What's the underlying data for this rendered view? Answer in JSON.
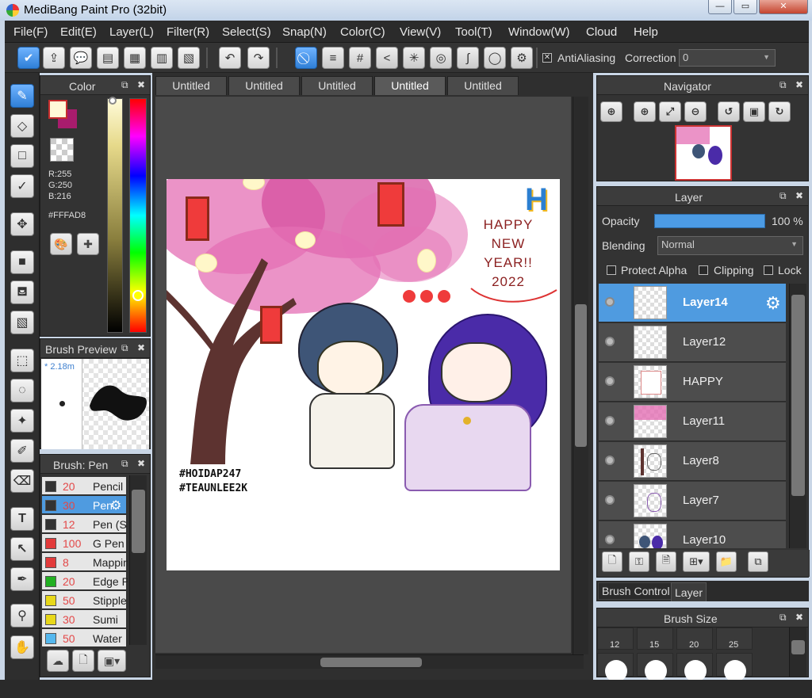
{
  "titlebar": {
    "title": "MediBang Paint Pro (32bit)"
  },
  "menu": [
    "File(F)",
    "Edit(E)",
    "Layer(L)",
    "Filter(R)",
    "Select(S)",
    "Snap(N)",
    "Color(C)",
    "View(V)",
    "Tool(T)",
    "Window(W)",
    "Cloud",
    "Help"
  ],
  "toolbar": {
    "antialiasing_label": "AntiAliasing",
    "correction_label": "Correction",
    "correction_value": "0"
  },
  "color_panel": {
    "title": "Color",
    "r": "R:255",
    "g": "G:250",
    "b": "B:216",
    "hex": "#FFFAD8",
    "fg_color": "#FFFAD8",
    "bg_color": "#A81C6D"
  },
  "brush_preview": {
    "title": "Brush Preview",
    "size": "* 2.18m"
  },
  "brush_panel": {
    "title": "Brush: Pen",
    "items": [
      {
        "size": "20",
        "name": "Pencil",
        "color": "#333333"
      },
      {
        "size": "30",
        "name": "Pen",
        "color": "#333333"
      },
      {
        "size": "12",
        "name": "Pen (S",
        "color": "#333333"
      },
      {
        "size": "100",
        "name": "G Pen",
        "color": "#e23b3b"
      },
      {
        "size": "8",
        "name": "Mappin",
        "color": "#e23b3b"
      },
      {
        "size": "20",
        "name": "Edge P",
        "color": "#22b022"
      },
      {
        "size": "50",
        "name": "Stipple",
        "color": "#e8d81a"
      },
      {
        "size": "30",
        "name": "Sumi",
        "color": "#e8d81a"
      },
      {
        "size": "50",
        "name": "Water",
        "color": "#55b8ee"
      }
    ]
  },
  "tabs": [
    "Untitled",
    "Untitled",
    "Untitled",
    "Untitled",
    "Untitled"
  ],
  "artwork": {
    "greeting": [
      "HAPPY",
      "NEW",
      "YEAR!!",
      "2022"
    ],
    "hashtags": [
      "#HOIDAP247",
      "#TEAUNLEE2K"
    ],
    "logo": "H"
  },
  "navigator": {
    "title": "Navigator"
  },
  "layer_panel": {
    "title": "Layer",
    "opacity_label": "Opacity",
    "opacity_value": "100 %",
    "opacity_level": 1.0,
    "blending_label": "Blending",
    "blending_value": "Normal",
    "protect_alpha": "Protect Alpha",
    "clipping": "Clipping",
    "lock": "Lock",
    "layers": [
      {
        "name": "Layer14"
      },
      {
        "name": "Layer12"
      },
      {
        "name": "HAPPY"
      },
      {
        "name": "Layer11"
      },
      {
        "name": "Layer8"
      },
      {
        "name": "Layer7"
      },
      {
        "name": "Layer10"
      }
    ]
  },
  "bottom_tabs": {
    "brush_control": "Brush Control",
    "layer": "Layer"
  },
  "brush_size_panel": {
    "title": "Brush Size",
    "sizes": [
      "12",
      "15",
      "20",
      "25"
    ]
  }
}
